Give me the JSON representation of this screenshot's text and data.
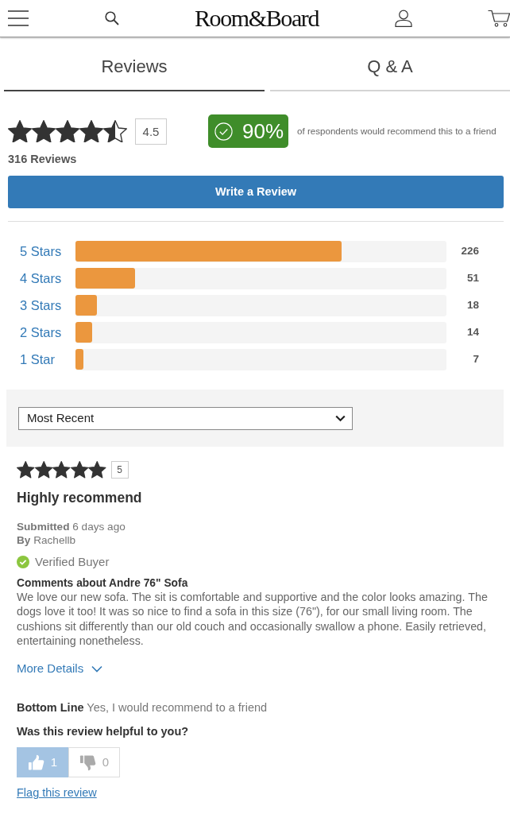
{
  "header": {
    "logo": "Room&Board"
  },
  "tabs": [
    {
      "label": "Reviews",
      "selected": true
    },
    {
      "label": "Q & A",
      "selected": false
    }
  ],
  "summary": {
    "stars": 4.5,
    "rating": "4.5",
    "recommend_percent": "90%",
    "recommend_text": "of respondents would recommend this to a friend",
    "review_count": "316 Reviews",
    "write_button": "Write a Review"
  },
  "histogram": [
    {
      "label": "5 Stars",
      "level": 0.717,
      "count": "226"
    },
    {
      "label": "4 Stars",
      "level": 0.161,
      "count": "51"
    },
    {
      "label": "3 Stars",
      "level": 0.057,
      "count": "18"
    },
    {
      "label": "2 Stars",
      "level": 0.044,
      "count": "14"
    },
    {
      "label": "1 Star",
      "level": 0.022,
      "count": "7"
    }
  ],
  "sort": {
    "value": "Most Recent"
  },
  "review": {
    "stars": 5,
    "rating": "5",
    "title": "Highly recommend",
    "submitted": "**Submitted** 6 days ago",
    "author": "**By** Rachellb",
    "verified": "Verified Buyer",
    "comments_heading": "Comments about Andre 76\" Sofa",
    "body": "We love our new sofa. The sit is comfortable and supportive and the color looks amazing. The dogs love it too! It was so nice to find a sofa in this size (76\"), for our small living room. The cushions sit differently than our old couch and occasionally swallow a phone. Easily retrieved, entertaining nonetheless.",
    "more_details": "More Details",
    "bottom_line": "**Bottom Line** Yes, I would recommend to a friend",
    "helpful_question": "Was this review helpful to you?",
    "votes": [
      {
        "kind": "up",
        "count": "1",
        "selected": true
      },
      {
        "kind": "down",
        "count": "0",
        "selected": false
      }
    ],
    "flag": "Flag this review"
  }
}
